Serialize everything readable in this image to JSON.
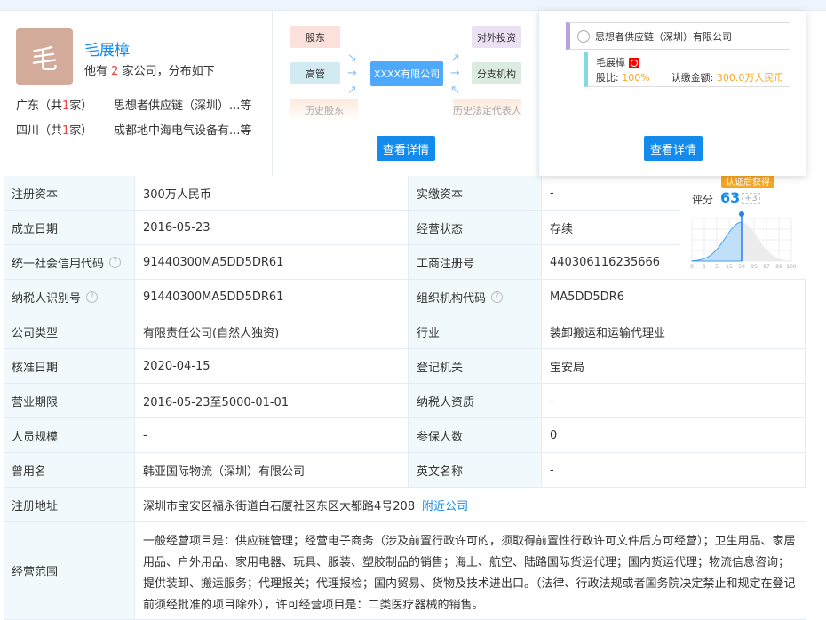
{
  "person": {
    "avatar_char": "毛",
    "name": "毛展樟",
    "summary_prefix": "他有",
    "company_count": "2",
    "summary_suffix": "家公司，分布如下",
    "regions": [
      {
        "label_prefix": "广东（共",
        "count": "1",
        "label_suffix": "家）",
        "company": "思想者供应链（深圳）...等"
      },
      {
        "label_prefix": "四川（共",
        "count": "1",
        "label_suffix": "家）",
        "company": "成都地中海电气设备有...等"
      }
    ]
  },
  "graph": {
    "shareholder": "股东",
    "executive": "高管",
    "history_shareholder": "历史股东",
    "center": "XXXX有限公司",
    "investment": "对外投资",
    "branch": "分支机构",
    "history_legal": "历史法定代表人",
    "details_button": "查看详情"
  },
  "equity": {
    "company": "思想者供应链（深圳）有限公司",
    "holder": "毛展樟",
    "ratio_label": "股比:",
    "ratio": "100%",
    "amount_label": "认缴金额:",
    "amount": "300.0万人民币",
    "details_button": "查看详情"
  },
  "score": {
    "badge": "认证后获得",
    "label": "评分",
    "value": "63",
    "delta": "+3",
    "ticks": [
      "0",
      "1",
      "5",
      "15",
      "50",
      "85",
      "97",
      "99",
      "100"
    ],
    "marker_percentile": 50
  },
  "table": {
    "rows": [
      [
        {
          "l": "注册资本",
          "v": "300万人民币"
        },
        {
          "l": "实缴资本",
          "v": "-"
        }
      ],
      [
        {
          "l": "成立日期",
          "v": "2016-05-23"
        },
        {
          "l": "经营状态",
          "v": "存续"
        }
      ],
      [
        {
          "l": "统一社会信用代码",
          "help": true,
          "v": "91440300MA5DD5DR61"
        },
        {
          "l": "工商注册号",
          "v": "440306116235666"
        }
      ],
      [
        {
          "l": "纳税人识别号",
          "help": true,
          "v": "91440300MA5DD5DR61"
        },
        {
          "l": "组织机构代码",
          "help": true,
          "v": "MA5DD5DR6"
        }
      ],
      [
        {
          "l": "公司类型",
          "v": "有限责任公司(自然人独资)"
        },
        {
          "l": "行业",
          "v": "装卸搬运和运输代理业"
        }
      ],
      [
        {
          "l": "核准日期",
          "v": "2020-04-15"
        },
        {
          "l": "登记机关",
          "v": "宝安局"
        }
      ],
      [
        {
          "l": "营业期限",
          "v": "2016-05-23至5000-01-01"
        },
        {
          "l": "纳税人资质",
          "v": "-"
        }
      ],
      [
        {
          "l": "人员规模",
          "v": "-"
        },
        {
          "l": "参保人数",
          "v": "0"
        }
      ],
      [
        {
          "l": "曾用名",
          "v": "韩亚国际物流（深圳）有限公司"
        },
        {
          "l": "英文名称",
          "v": "-"
        }
      ]
    ],
    "address": {
      "l": "注册地址",
      "v": "深圳市宝安区福永街道白石厦社区东区大都路4号208",
      "link": "附近公司"
    },
    "scope": {
      "l": "经营范围",
      "v": "一般经营项目是：供应链管理；经营电子商务（涉及前置行政许可的，须取得前置性行政许可文件后方可经营）；卫生用品、家居用品、户外用品、家用电器、玩具、服装、塑胶制品的销售；海上、航空、陆路国际货运代理；国内货运代理；物流信息咨询；提供装卸、搬运服务；代理报关；代理报检；国内贸易、货物及技术进出口。（法律、行政法规或者国务院决定禁止和规定在登记前须经批准的项目除外），许可经营项目是：二类医疗器械的销售。"
    }
  },
  "colors": {
    "accent": "#128bed",
    "label_bg": "#f2f9fc",
    "orange": "#f5a623"
  }
}
